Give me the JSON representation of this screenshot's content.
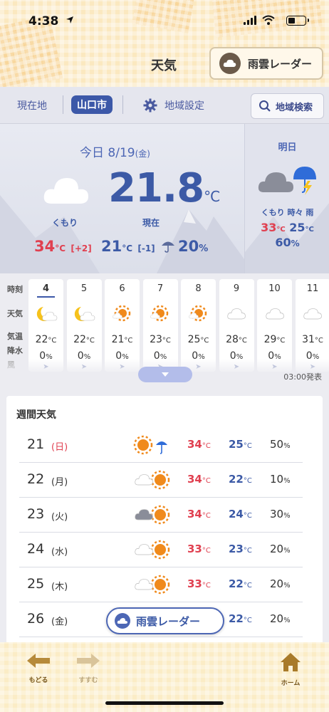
{
  "status_bar": {
    "time": "4:38"
  },
  "header": {
    "title": "天気",
    "radar_button": "雨雲レーダー"
  },
  "location_bar": {
    "current": "現在地",
    "selected": "山口市",
    "settings": "地域設定",
    "search": "地域検索"
  },
  "today": {
    "date": "今日 8/19",
    "weekday": "(金)",
    "temp": "21.8",
    "temp_unit": "°C",
    "weather": "くもり",
    "now_label": "現在",
    "high": "34",
    "high_diff": "[+2]",
    "low": "21",
    "low_diff": "[-1]",
    "rain": "20",
    "rain_unit": "%",
    "unit": "°C"
  },
  "tomorrow": {
    "title": "明日",
    "weather": "くもり 時々 雨",
    "high": "33",
    "low": "25",
    "rain": "60",
    "unit": "°C",
    "rain_unit": "%"
  },
  "hourly": {
    "labels": {
      "hour": "時刻",
      "weather": "天気",
      "temp": "気温",
      "rain": "降水",
      "wind": "風"
    },
    "issued": "03:00発表",
    "hours": [
      {
        "hour": "4",
        "icon": "moon-cloud-icon",
        "temp": "22",
        "rain": "0"
      },
      {
        "hour": "5",
        "icon": "moon-cloud-icon",
        "temp": "22",
        "rain": "0"
      },
      {
        "hour": "6",
        "icon": "sun-cloud-icon",
        "temp": "21",
        "rain": "0"
      },
      {
        "hour": "7",
        "icon": "sun-cloud-icon",
        "temp": "23",
        "rain": "0"
      },
      {
        "hour": "8",
        "icon": "sun-cloud-icon",
        "temp": "25",
        "rain": "0"
      },
      {
        "hour": "9",
        "icon": "cloud-icon",
        "temp": "28",
        "rain": "0"
      },
      {
        "hour": "10",
        "icon": "cloud-icon",
        "temp": "29",
        "rain": "0"
      },
      {
        "hour": "11",
        "icon": "cloud-icon",
        "temp": "31",
        "rain": "0"
      }
    ],
    "temp_unit": "°C",
    "rain_unit": "%"
  },
  "weekly": {
    "title": "週間天気",
    "days": [
      {
        "day": "21",
        "dow": "(日)",
        "icon": "sun-umbrella-icon",
        "high": "34",
        "low": "25",
        "rain": "50"
      },
      {
        "day": "22",
        "dow": "(月)",
        "icon": "cloud-sun-icon",
        "high": "34",
        "low": "22",
        "rain": "10"
      },
      {
        "day": "23",
        "dow": "(火)",
        "icon": "darkcloud-sun-icon",
        "high": "34",
        "low": "24",
        "rain": "30"
      },
      {
        "day": "24",
        "dow": "(水)",
        "icon": "cloud-sun-icon",
        "high": "33",
        "low": "23",
        "rain": "20"
      },
      {
        "day": "25",
        "dow": "(木)",
        "icon": "cloud-sun-icon",
        "high": "33",
        "low": "22",
        "rain": "20"
      },
      {
        "day": "26",
        "dow": "(金)",
        "icon": "cloud-sun-icon",
        "high": "",
        "low": "22",
        "rain": "20"
      }
    ],
    "unit": "°C",
    "rain_unit": "%"
  },
  "floating_radar": "雨雲レーダー",
  "bottom_nav": {
    "back": "もどる",
    "forward": "すすむ",
    "home": "ホーム"
  },
  "colors": {
    "accent_blue": "#3c5aa6",
    "hot_red": "#e04050",
    "header_yellow": "#fbe8c0"
  }
}
